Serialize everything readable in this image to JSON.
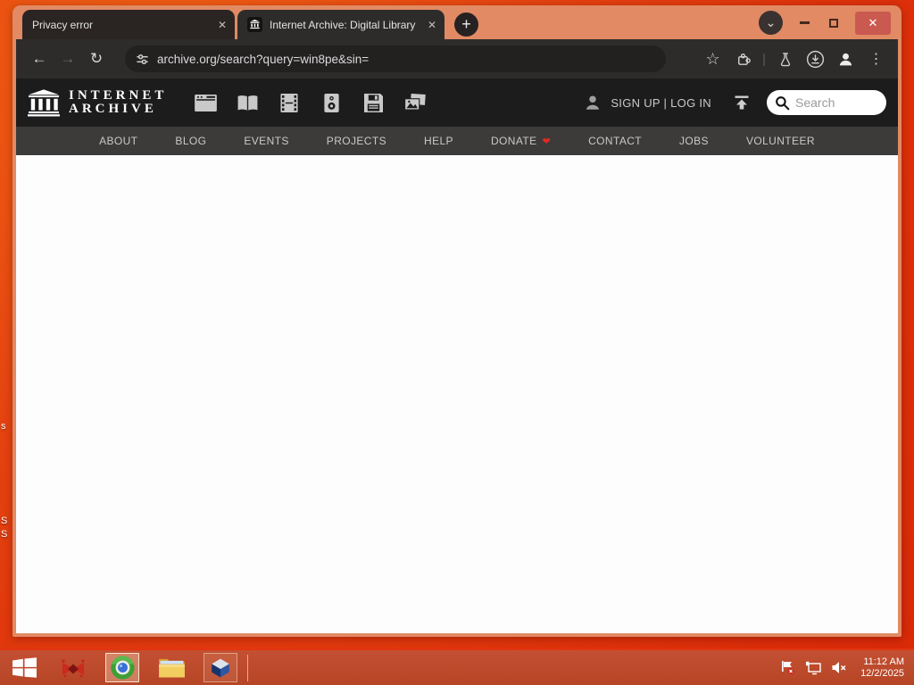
{
  "browser": {
    "tabs": [
      {
        "title": "Privacy error",
        "active": false
      },
      {
        "title": "Internet Archive: Digital Library",
        "active": true
      }
    ],
    "url": "archive.org/search?query=win8pe&sin="
  },
  "icons": {
    "close": "✕",
    "plus": "+",
    "chevron_down": "⌄",
    "back": "←",
    "forward": "→",
    "reload": "↻",
    "star": "☆",
    "kebab": "⋮",
    "pipe": "|",
    "heart": "❤"
  },
  "ia": {
    "logo_line1": "INTERNET",
    "logo_line2": "ARCHIVE",
    "signup_login": "SIGN UP | LOG IN",
    "search_placeholder": "Search",
    "nav": [
      {
        "label": "ABOUT"
      },
      {
        "label": "BLOG"
      },
      {
        "label": "EVENTS"
      },
      {
        "label": "PROJECTS"
      },
      {
        "label": "HELP"
      },
      {
        "label": "DONATE"
      },
      {
        "label": "CONTACT"
      },
      {
        "label": "JOBS"
      },
      {
        "label": "VOLUNTEER"
      }
    ]
  },
  "taskbar": {
    "time": "11:12 AM",
    "date": "12/2/2025"
  },
  "desktop": {
    "fragments": [
      "s",
      "S",
      "S"
    ]
  }
}
